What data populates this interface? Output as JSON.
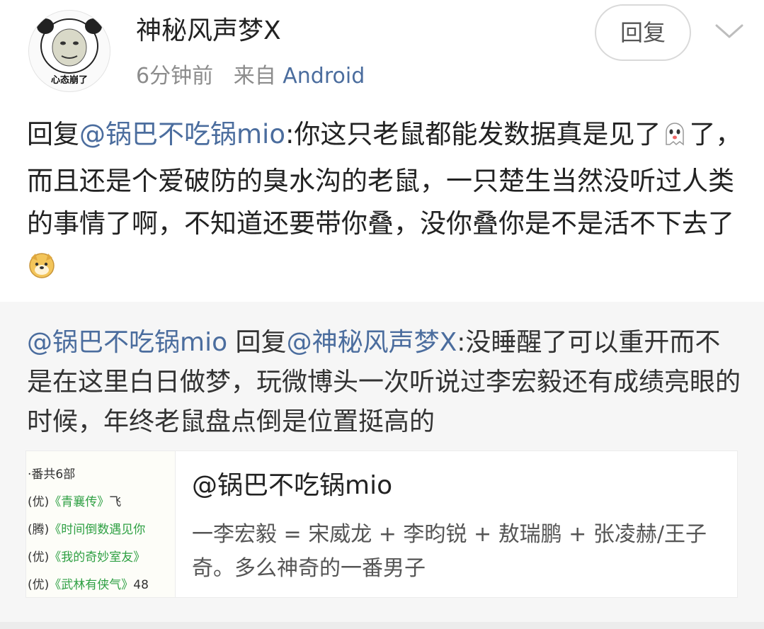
{
  "header": {
    "avatar_caption": "心态崩了",
    "username": "神秘风声梦X",
    "time": "6分钟前",
    "source_prefix": "来自",
    "source_app": "Android",
    "reply_button": "回复",
    "menu_icon": "chevron-down-icon"
  },
  "comment": {
    "prefix": "回复",
    "mention": "@锅巴不吃锅mio",
    "text_1": ":你这只老鼠都能发数据真是见了",
    "emoji_1": "ghost-emoji",
    "text_2": "了，而且还是个爱破防的臭水沟的老鼠，一只楚生当然没听过人类的事情了啊，不知道还要带你叠，没你叠你是不是活不下去了",
    "emoji_2": "doge-emoji"
  },
  "quote": {
    "author": "@锅巴不吃锅mio",
    "reply_word": " 回复",
    "mention": "@神秘风声梦X",
    "text": ":没睡醒了可以重开而不是在这里白日做梦，玩微博头一次听说过李宏毅还有成绩亮眼的时候，年终老鼠盘点倒是位置挺高的"
  },
  "card": {
    "thumbnail": {
      "lines": [
        {
          "prefix": "·番共6部",
          "title": "",
          "suffix": ""
        },
        {
          "prefix": "(优)",
          "title": "《青襄传》",
          "suffix": "飞"
        },
        {
          "prefix": "(腾)",
          "title": "《时间倒数遇见你",
          "suffix": ""
        },
        {
          "prefix": "(优)",
          "title": "《我的奇妙室友》",
          "suffix": ""
        },
        {
          "prefix": "(优)",
          "title": "《武林有侠气》",
          "suffix": "48"
        }
      ]
    },
    "title": "@锅巴不吃锅mio",
    "description": "一李宏毅 = 宋威龙 + 李昀锐 + 敖瑞鹏 + 张凌赫/王子奇。多么神奇的一番男子"
  }
}
